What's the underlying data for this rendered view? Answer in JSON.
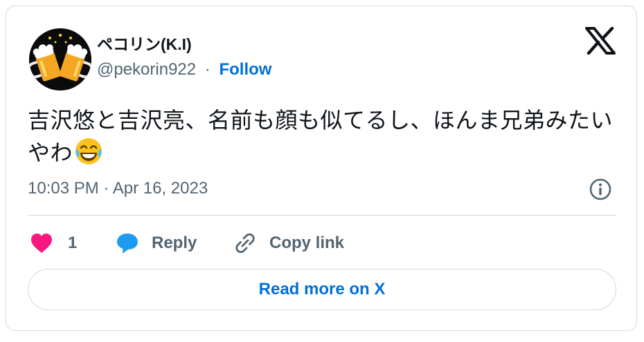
{
  "author": {
    "display_name": "ペコリン(K.I)",
    "handle": "@pekorin922",
    "separator": "·",
    "follow_label": "Follow",
    "avatar_icon": "beer-mugs-cheers-icon"
  },
  "brand": {
    "logo_icon": "x-logo-icon"
  },
  "tweet": {
    "text": "吉沢悠と吉沢亮、名前も顔も似てるし、ほんま兄弟みたいやわ",
    "emoji_icon": "face-with-tears-of-joy-icon",
    "timestamp": "10:03 PM · Apr 16, 2023",
    "info_icon": "info-circle-icon"
  },
  "actions": {
    "like_count": "1",
    "like_icon": "heart-icon",
    "reply_label": "Reply",
    "reply_icon": "speech-bubble-icon",
    "copy_label": "Copy link",
    "copy_icon": "link-icon"
  },
  "read_more_label": "Read more on X",
  "colors": {
    "link_blue": "#006fd6",
    "heart_pink": "#f91880",
    "reply_blue": "#1d9bf0",
    "secondary_text": "#536471",
    "border": "#cfd9de"
  }
}
